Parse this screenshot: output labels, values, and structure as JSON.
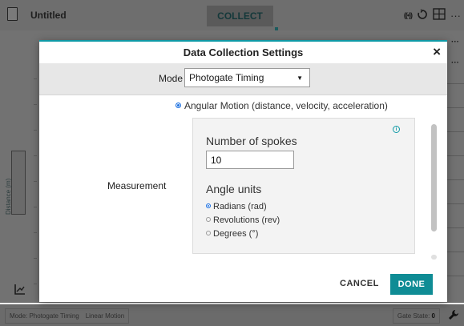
{
  "app": {
    "title": "Untitled",
    "collect_label": "COLLECT",
    "axis_label": "Distance (m)",
    "sensor_icon": "((•))",
    "more_label": "···"
  },
  "statusbar": {
    "mode_text": "Mode: Photogate Timing",
    "submode_text": "Linear Motion",
    "gate_label": "Gate State:",
    "gate_value": "0"
  },
  "dialog": {
    "title": "Data Collection Settings",
    "close_label": "×",
    "mode_label": "Mode",
    "mode_value": "Photogate Timing",
    "motion_option": "Angular Motion (distance, velocity, acceleration)",
    "measurement_label": "Measurement",
    "spokes_label": "Number of spokes",
    "spokes_value": "10",
    "info_icon": "i",
    "angle_units_label": "Angle units",
    "angle_options": [
      {
        "label": "Radians (rad)",
        "checked": true
      },
      {
        "label": "Revolutions (rev)",
        "checked": false
      },
      {
        "label": "Degrees (°)",
        "checked": false
      }
    ],
    "cancel_label": "CANCEL",
    "done_label": "DONE"
  },
  "colors": {
    "accent": "#0f9aa6",
    "done_button": "#0f8c95",
    "radio_selected": "#1b6fe0",
    "overlay": "#727272"
  }
}
